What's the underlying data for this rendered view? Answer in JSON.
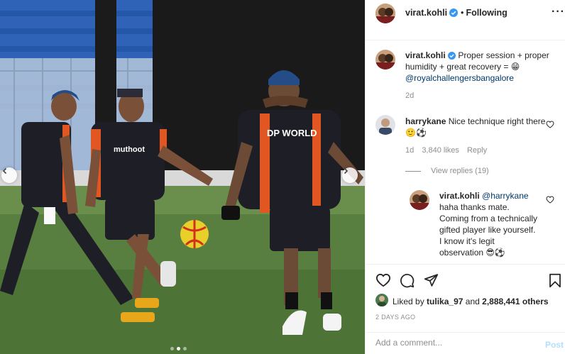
{
  "post": {
    "username": "virat.kohli",
    "separator": "•",
    "follow_status": "Following",
    "more_icon": "more-options-icon",
    "verified_icon": "verified-badge-icon"
  },
  "caption": {
    "username": "virat.kohli",
    "text": "Proper session + proper humidity + great recovery = 😁",
    "mention": "@royalchallengersbangalore",
    "time": "2d"
  },
  "comments": [
    {
      "username": "harrykane",
      "text": "Nice technique right there 🙂⚽",
      "time": "1d",
      "likes": "3,840 likes",
      "reply_label": "Reply",
      "view_replies": "View replies (19)"
    }
  ],
  "reply": {
    "username": "virat.kohli",
    "mention": "@harrykane",
    "text": "haha thanks mate. Coming from a technically gifted player like yourself. I know it's legit observation 😎⚽"
  },
  "actions": {
    "liked_by_prefix": "Liked by",
    "liked_by_user": "tulika_97",
    "and_label": "and",
    "others": "2,888,441 others",
    "posted": "2 DAYS AGO"
  },
  "add_comment": {
    "placeholder": "Add a comment...",
    "post_label": "Post"
  },
  "carousel": {
    "slides": 3,
    "active": 1
  },
  "colors": {
    "link": "#00376b",
    "verified": "#3897f0",
    "post_disabled": "#b2dffc",
    "meta": "#8e8e8e"
  }
}
